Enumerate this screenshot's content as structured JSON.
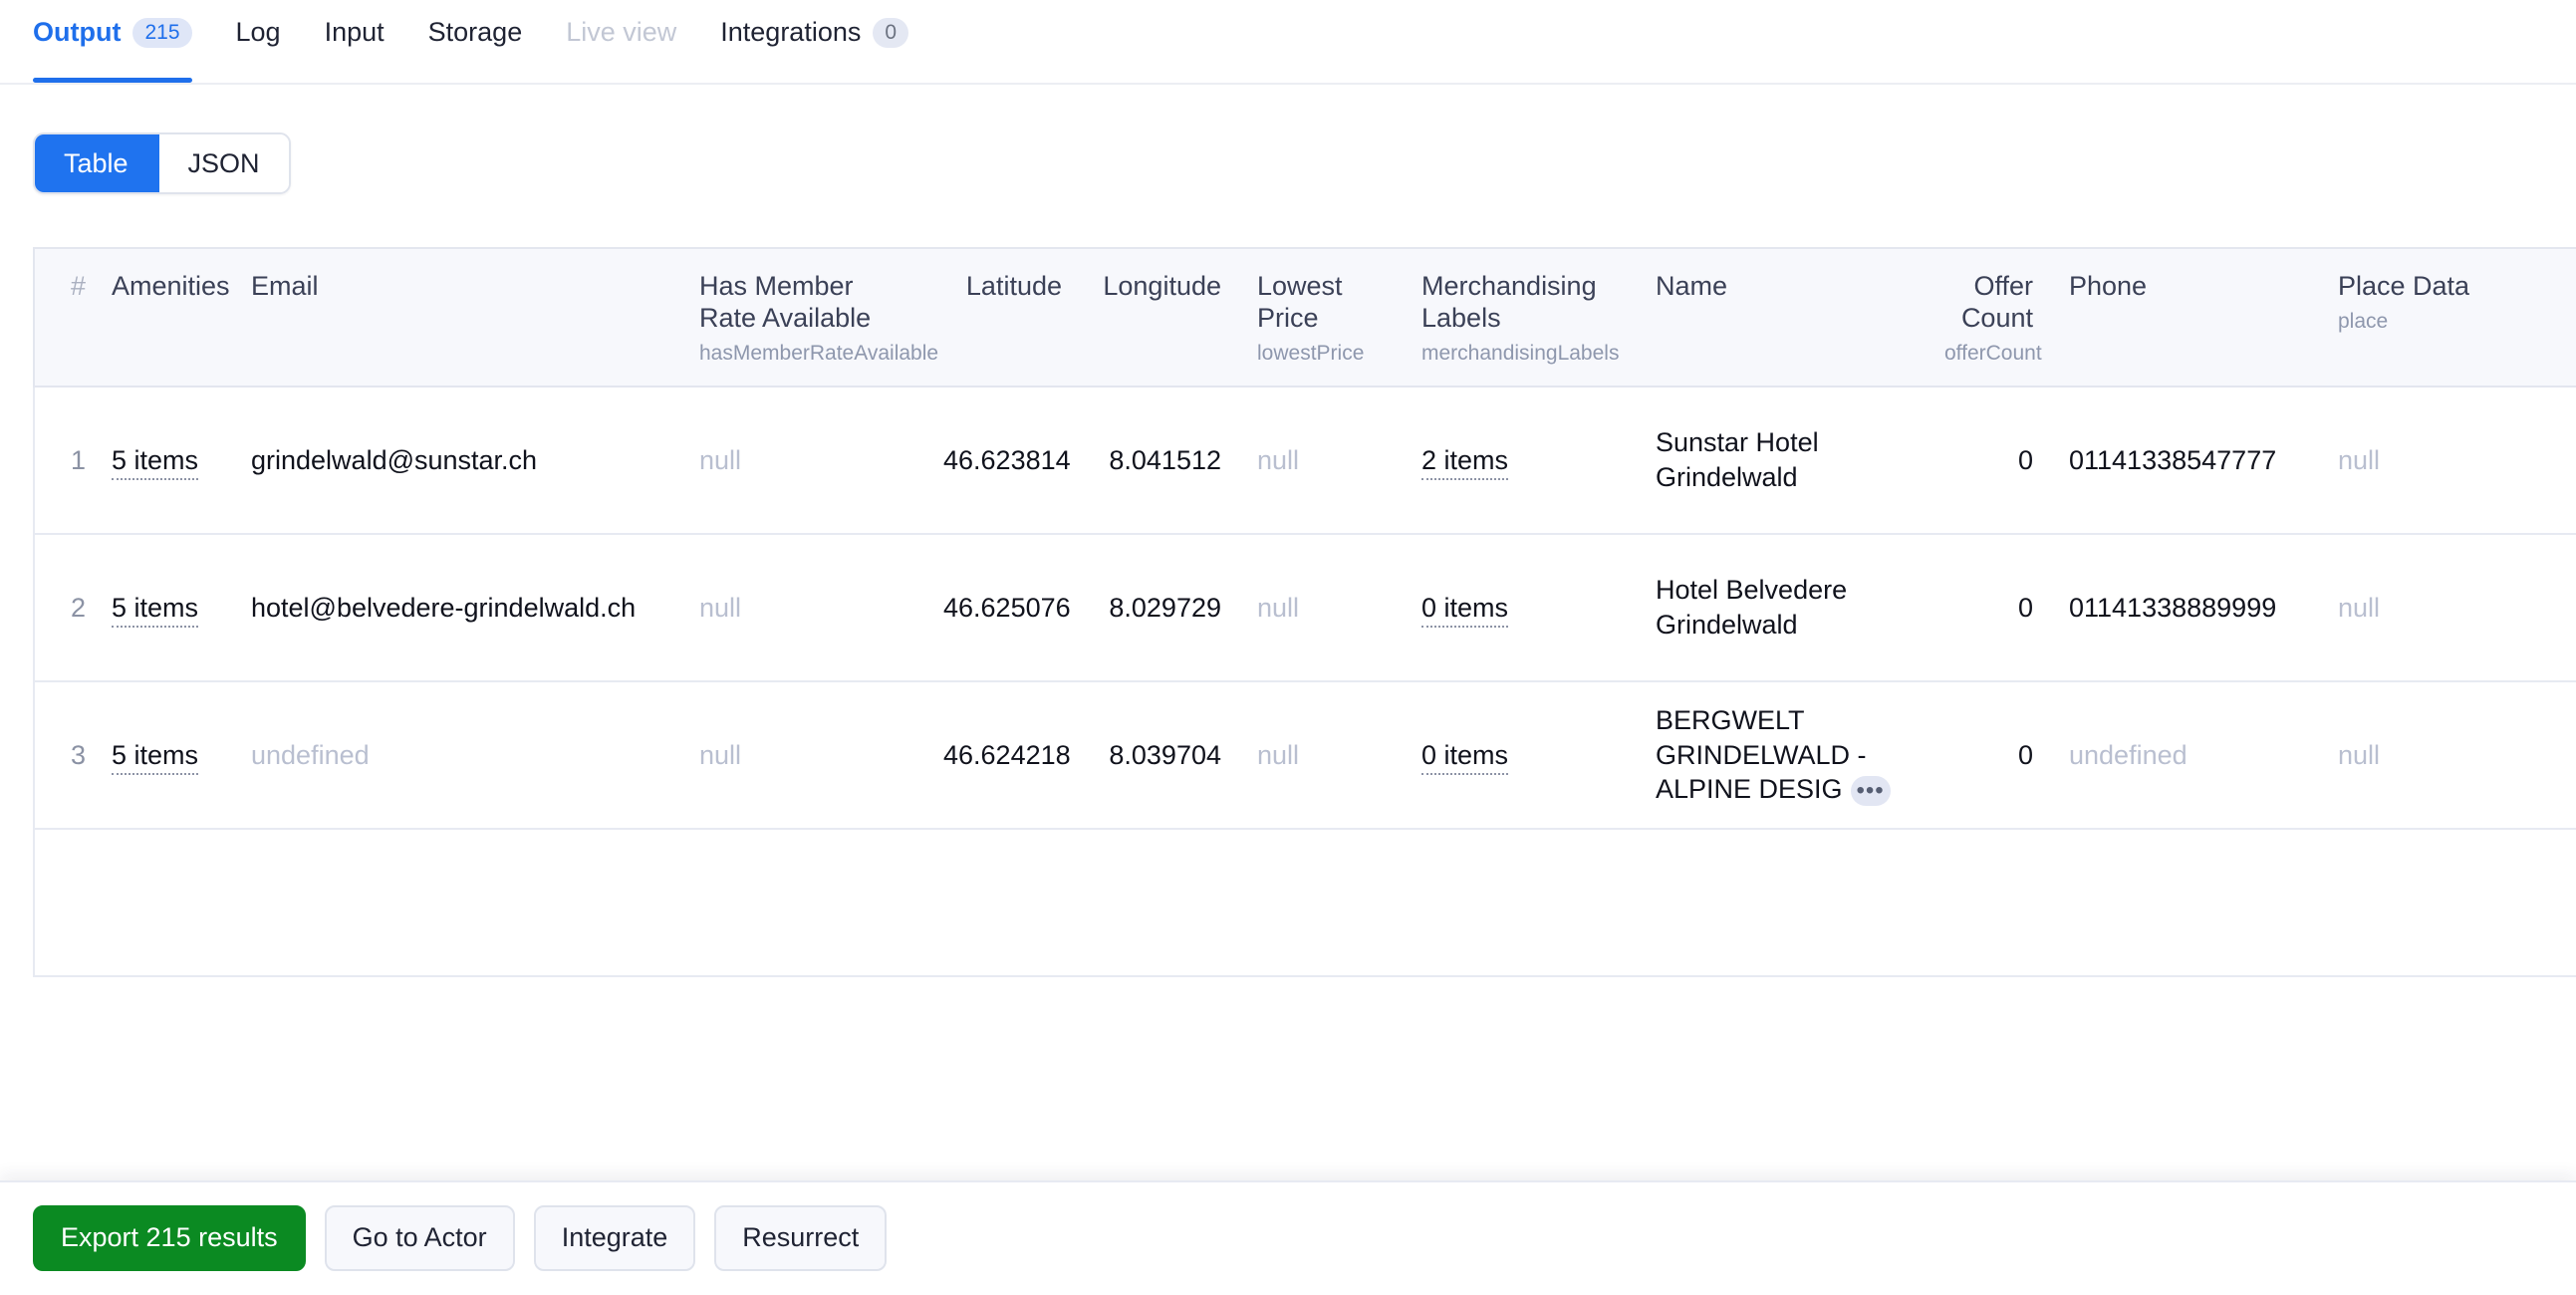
{
  "tabs": [
    {
      "label": "Output",
      "count": "215",
      "state": "active"
    },
    {
      "label": "Log",
      "count": "",
      "state": "normal"
    },
    {
      "label": "Input",
      "count": "",
      "state": "normal"
    },
    {
      "label": "Storage",
      "count": "",
      "state": "normal"
    },
    {
      "label": "Live view",
      "count": "",
      "state": "disabled"
    },
    {
      "label": "Integrations",
      "count": "0",
      "state": "normal"
    }
  ],
  "view_toggle": {
    "table_label": "Table",
    "json_label": "JSON",
    "selected": "Table"
  },
  "table": {
    "index_header": "#",
    "columns": [
      {
        "title": "Amenities",
        "field": "",
        "align": "left"
      },
      {
        "title": "Email",
        "field": "",
        "align": "left"
      },
      {
        "title": "Has Member Rate Available",
        "field": "hasMemberRateAvailable",
        "align": "left"
      },
      {
        "title": "Latitude",
        "field": "",
        "align": "right"
      },
      {
        "title": "Longitude",
        "field": "",
        "align": "right"
      },
      {
        "title": "Lowest Price",
        "field": "lowestPrice",
        "align": "left"
      },
      {
        "title": "Merchandising Labels",
        "field": "merchandisingLabels",
        "align": "left"
      },
      {
        "title": "Name",
        "field": "",
        "align": "left"
      },
      {
        "title": "Offer Count",
        "field": "offerCount",
        "align": "right"
      },
      {
        "title": "Phone",
        "field": "",
        "align": "left"
      },
      {
        "title": "Place Data",
        "field": "place",
        "align": "left"
      }
    ],
    "rows": [
      {
        "index": "1",
        "amenities": "5 items",
        "email": "grindelwald@sunstar.ch",
        "has_member_rate_available": "null",
        "latitude": "46.623814",
        "longitude": "8.041512",
        "lowest_price": "null",
        "merchandising_labels": "2 items",
        "name": "Sunstar Hotel Grindelwald",
        "name_truncated": false,
        "offer_count": "0",
        "phone": "01141338547777",
        "place_data": "null"
      },
      {
        "index": "2",
        "amenities": "5 items",
        "email": "hotel@belvedere-grindelwald.ch",
        "has_member_rate_available": "null",
        "latitude": "46.625076",
        "longitude": "8.029729",
        "lowest_price": "null",
        "merchandising_labels": "0 items",
        "name": "Hotel Belvedere Grindelwald",
        "name_truncated": false,
        "offer_count": "0",
        "phone": "01141338889999",
        "place_data": "null"
      },
      {
        "index": "3",
        "amenities": "5 items",
        "email": "undefined",
        "has_member_rate_available": "null",
        "latitude": "46.624218",
        "longitude": "8.039704",
        "lowest_price": "null",
        "merchandising_labels": "0 items",
        "name": "BERGWELT GRINDELWALD - ALPINE DESIG",
        "name_truncated": true,
        "truncation_glyph": "•••",
        "offer_count": "0",
        "phone": "undefined",
        "place_data": "null"
      }
    ]
  },
  "footer": {
    "export_label": "Export 215 results",
    "go_to_actor_label": "Go to Actor",
    "integrate_label": "Integrate",
    "resurrect_label": "Resurrect"
  },
  "colors": {
    "accent": "#1f6feb",
    "toggle_selected": "#1f73ef",
    "export_green": "#0b8a22",
    "header_bg": "#f7f8fc",
    "muted_text": "#b9bfd0"
  }
}
